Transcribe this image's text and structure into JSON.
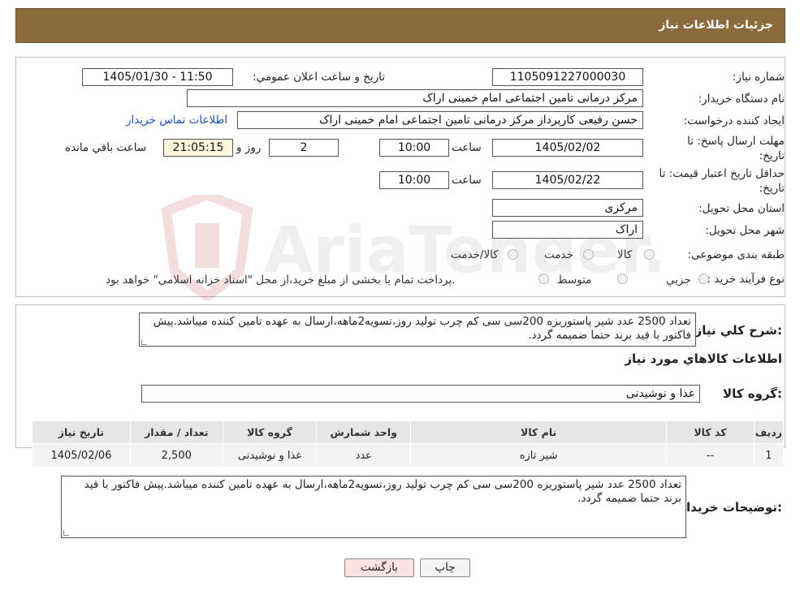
{
  "header": {
    "title": "جزئیات اطلاعات نیاز"
  },
  "form": {
    "need_number": {
      "label": "شماره نیاز:",
      "value": "1105091227000030"
    },
    "announce_datetime": {
      "label": "تاریخ و ساعت اعلان عمومي:",
      "value": "1405/01/30 - 11:50"
    },
    "buyer_org": {
      "label": "نام دستگاه خريدار:",
      "value": "مرکز درمانی تامین اجتماعی امام خمینی اراک"
    },
    "requester": {
      "label": "ايجاد کننده درخواست:",
      "value": "حسن رفیعی کارپرداز مرکز درمانی تامین اجتماعی امام خمینی اراک",
      "contact_link": "اطلاعات تماس خريدار"
    },
    "reply_deadline": {
      "label": "مهلت ارسال پاسخ: تا تاريخ:",
      "date": "1405/02/02",
      "time_label": "ساعت",
      "time": "10:00",
      "days": "2",
      "days_label": "روز و",
      "remaining": "21:05:15",
      "remaining_label": "ساعت باقي مانده"
    },
    "price_validity": {
      "label": "حداقل تاريخ اعتبار قيمت: تا تاريخ:",
      "date": "1405/02/22",
      "time_label": "ساعت",
      "time": "10:00"
    },
    "province": {
      "label": "استان محل تحويل:",
      "value": "مرکزی"
    },
    "city": {
      "label": "شهر محل تحويل:",
      "value": "اراک"
    },
    "category": {
      "label": "طبقه بندی موضوعی:",
      "options": [
        "کالا",
        "خدمت",
        "کالا/خدمت"
      ]
    },
    "purchase_type": {
      "label": "نوع فرآيند خريد :",
      "options": [
        "جزيي",
        "متوسط"
      ],
      "note": "پرداخت تمام يا بخشی از مبلغ خريد،از محل \"اسناد خزانه اسلامی\" خواهد بود."
    }
  },
  "description": {
    "label": "شرح کلي نياز:",
    "text": "تعداد 2500 عدد شیر پاستوریزه 200سی سی کم چرب تولید روز،تسویه2ماهه،ارسال به عهده تامین کننده میباشد.پیش فاکتور با قید برند حتما ضمیمه گردد."
  },
  "goods": {
    "section_title": "اطلاعات کالاهاي مورد نياز",
    "group_label": "گروه کالا:",
    "group_value": "غذا و نوشیدنی",
    "table": {
      "headers": [
        "رديف",
        "کد کالا",
        "نام کالا",
        "واحد شمارش",
        "گروه کالا",
        "تعداد / مقدار",
        "تاريخ نياز"
      ],
      "rows": [
        [
          "1",
          "--",
          "شیر تازه",
          "عدد",
          "غذا و نوشیدنی",
          "2,500",
          "1405/02/06"
        ]
      ]
    }
  },
  "buyer_notes": {
    "label": "توضيحات خريدار:",
    "text": "تعداد 2500 عدد شیر پاستوریزه 200سی سی کم چرب تولید روز،تسویه2ماهه،ارسال به عهده تامین کننده میباشد.پیش فاکتور با قید برند حتما ضمیمه گردد."
  },
  "buttons": {
    "print": "چاپ",
    "back": "بازگشت"
  },
  "watermark": {
    "text": "AriaTender.neT"
  },
  "colors": {
    "header_bg": "#8b6b3e",
    "link": "#1a4fc2",
    "back_button_bg": "#fbe3e3"
  }
}
